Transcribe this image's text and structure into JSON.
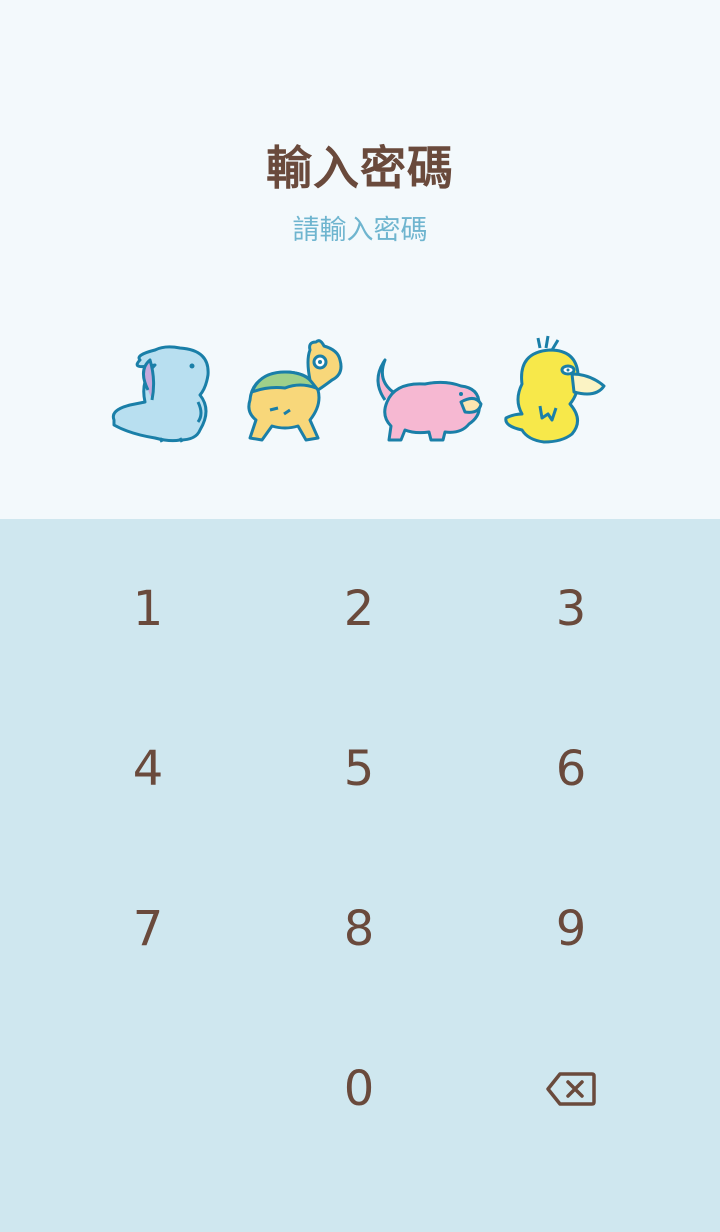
{
  "header": {
    "title": "輸入密碼",
    "subtitle": "請輸入密碼"
  },
  "mascots": [
    "quagsire-icon",
    "numel-icon",
    "slowpoke-icon",
    "psyduck-icon"
  ],
  "keypad": {
    "keys": [
      "1",
      "2",
      "3",
      "4",
      "5",
      "6",
      "7",
      "8",
      "9",
      "0"
    ],
    "backspace_icon": "backspace-icon"
  },
  "colors": {
    "top_background": "#f3f9fc",
    "keypad_background": "#cfe7ef",
    "title": "#6a4a3c",
    "subtitle": "#6fb5cf",
    "key_text": "#6a4a3c"
  }
}
